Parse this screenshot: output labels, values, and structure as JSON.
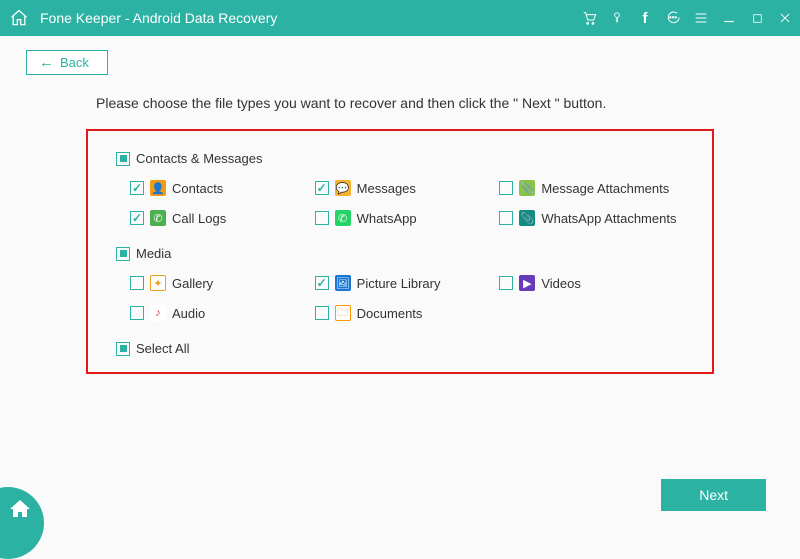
{
  "titlebar": {
    "title": "Fone Keeper - Android Data Recovery"
  },
  "back": {
    "label": "Back"
  },
  "instruction": "Please choose the file types you want to recover and then click the \" Next \" button.",
  "categories": {
    "contacts_messages": {
      "label": "Contacts & Messages"
    },
    "media": {
      "label": "Media"
    }
  },
  "items": {
    "contacts": {
      "label": "Contacts"
    },
    "messages": {
      "label": "Messages"
    },
    "msg_attach": {
      "label": "Message Attachments"
    },
    "call_logs": {
      "label": "Call Logs"
    },
    "whatsapp": {
      "label": "WhatsApp"
    },
    "whatsapp_attach": {
      "label": "WhatsApp Attachments"
    },
    "gallery": {
      "label": "Gallery"
    },
    "picture_library": {
      "label": "Picture Library"
    },
    "videos": {
      "label": "Videos"
    },
    "audio": {
      "label": "Audio"
    },
    "documents": {
      "label": "Documents"
    }
  },
  "select_all": {
    "label": "Select All"
  },
  "next": {
    "label": "Next"
  },
  "colors": {
    "accent": "#2bb2a3",
    "highlight_border": "#e31919",
    "ico": {
      "contacts": "#f39c12",
      "messages": "#f5b333",
      "msg_attach": "#8bc34a",
      "call_logs": "#4caf50",
      "whatsapp": "#25d366",
      "whatsapp_attach": "#128c7e",
      "gallery": "#ff9800",
      "picture_library": "#1976d2",
      "videos": "#673ab7",
      "audio": "#e53935",
      "documents": "#ff9800"
    }
  }
}
